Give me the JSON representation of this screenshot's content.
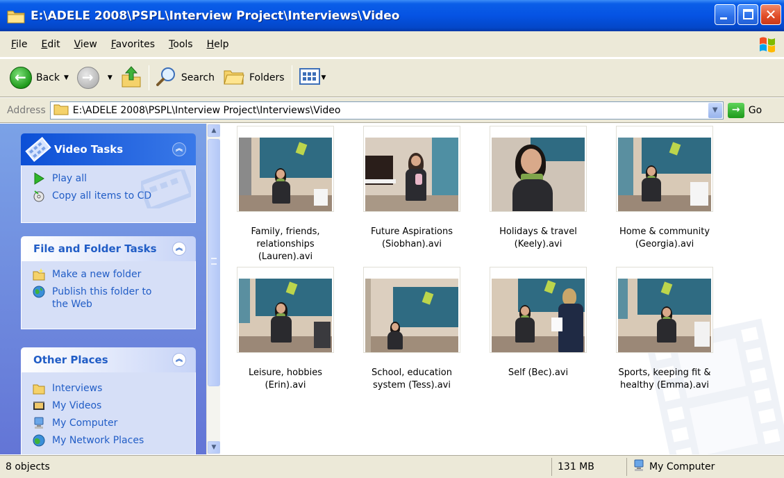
{
  "window": {
    "title": "E:\\ADELE 2008\\PSPL\\Interview Project\\Interviews\\Video"
  },
  "menu": [
    "File",
    "Edit",
    "View",
    "Favorites",
    "Tools",
    "Help"
  ],
  "toolbar": {
    "back_label": "Back",
    "search_label": "Search",
    "folders_label": "Folders"
  },
  "address": {
    "label": "Address",
    "value": "E:\\ADELE 2008\\PSPL\\Interview Project\\Interviews\\Video",
    "go_label": "Go"
  },
  "taskpane": {
    "video_tasks": {
      "title": "Video Tasks",
      "items": [
        "Play all",
        "Copy all items to CD"
      ]
    },
    "file_folder_tasks": {
      "title": "File and Folder Tasks",
      "items": [
        "Make a new folder",
        "Publish this folder to the Web"
      ]
    },
    "other_places": {
      "title": "Other Places",
      "items": [
        "Interviews",
        "My Videos",
        "My Computer",
        "My Network Places"
      ]
    }
  },
  "files": [
    {
      "name": "Family, friends, relationships (Lauren).avi"
    },
    {
      "name": "Future Aspirations (Siobhan).avi"
    },
    {
      "name": "Holidays & travel (Keely).avi"
    },
    {
      "name": "Home & community (Georgia).avi"
    },
    {
      "name": "Leisure, hobbies (Erin).avi"
    },
    {
      "name": "School, education system (Tess).avi"
    },
    {
      "name": "Self (Bec).avi"
    },
    {
      "name": "Sports, keeping fit & healthy (Emma).avi"
    }
  ],
  "status": {
    "objects": "8 objects",
    "size": "131 MB",
    "location": "My Computer"
  },
  "colors": {
    "titlebar": "#0553e3",
    "taskpane": "#7ba2e7",
    "link": "#215dc6"
  }
}
